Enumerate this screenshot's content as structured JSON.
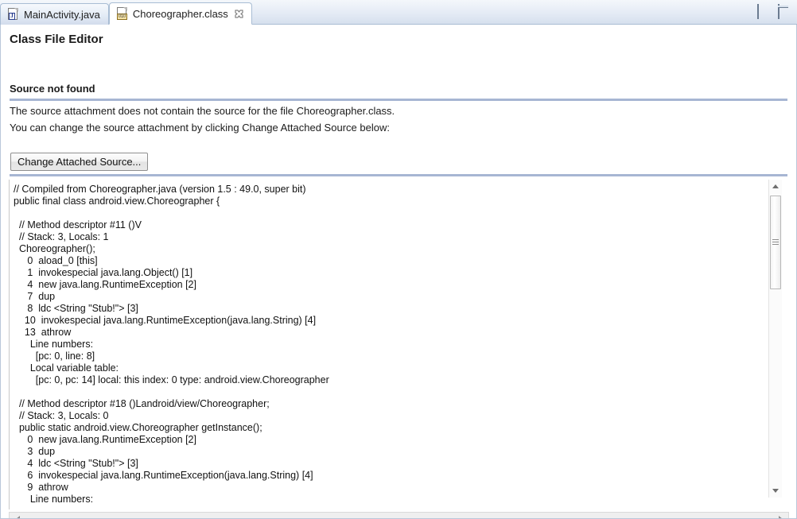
{
  "window": {
    "minimize_label": "Minimize",
    "maximize_label": "Maximize"
  },
  "tabs": [
    {
      "label": "MainActivity.java",
      "icon": "java-file-icon",
      "active": false,
      "closable": false
    },
    {
      "label": "Choreographer.class",
      "icon": "class-file-icon",
      "active": true,
      "closable": true,
      "icon_text": "010"
    }
  ],
  "editor": {
    "title": "Class File Editor",
    "section_title": "Source not found",
    "paragraph_1": "The source attachment does not contain the source for the file Choreographer.class.",
    "paragraph_2": "You can change the source attachment by clicking Change Attached Source below:",
    "button_label": "Change Attached Source...",
    "code": "// Compiled from Choreographer.java (version 1.5 : 49.0, super bit)\npublic final class android.view.Choreographer {\n\n  // Method descriptor #11 ()V\n  // Stack: 3, Locals: 1\n  Choreographer();\n     0  aload_0 [this]\n     1  invokespecial java.lang.Object() [1]\n     4  new java.lang.RuntimeException [2]\n     7  dup\n     8  ldc <String \"Stub!\"> [3]\n    10  invokespecial java.lang.RuntimeException(java.lang.String) [4]\n    13  athrow\n      Line numbers:\n        [pc: 0, line: 8]\n      Local variable table:\n        [pc: 0, pc: 14] local: this index: 0 type: android.view.Choreographer\n\n  // Method descriptor #18 ()Landroid/view/Choreographer;\n  // Stack: 3, Locals: 0\n  public static android.view.Choreographer getInstance();\n     0  new java.lang.RuntimeException [2]\n     3  dup\n     4  ldc <String \"Stub!\"> [3]\n     6  invokespecial java.lang.RuntimeException(java.lang.String) [4]\n     9  athrow\n      Line numbers:"
  },
  "scrollbars": {
    "vertical_up": "scroll-up",
    "vertical_down": "scroll-down",
    "horizontal_left": "scroll-left",
    "horizontal_right": "scroll-right"
  },
  "colors": {
    "rule": "#a7b6d3",
    "tab_border": "#a9bdd4",
    "text": "#1b1b1b"
  }
}
